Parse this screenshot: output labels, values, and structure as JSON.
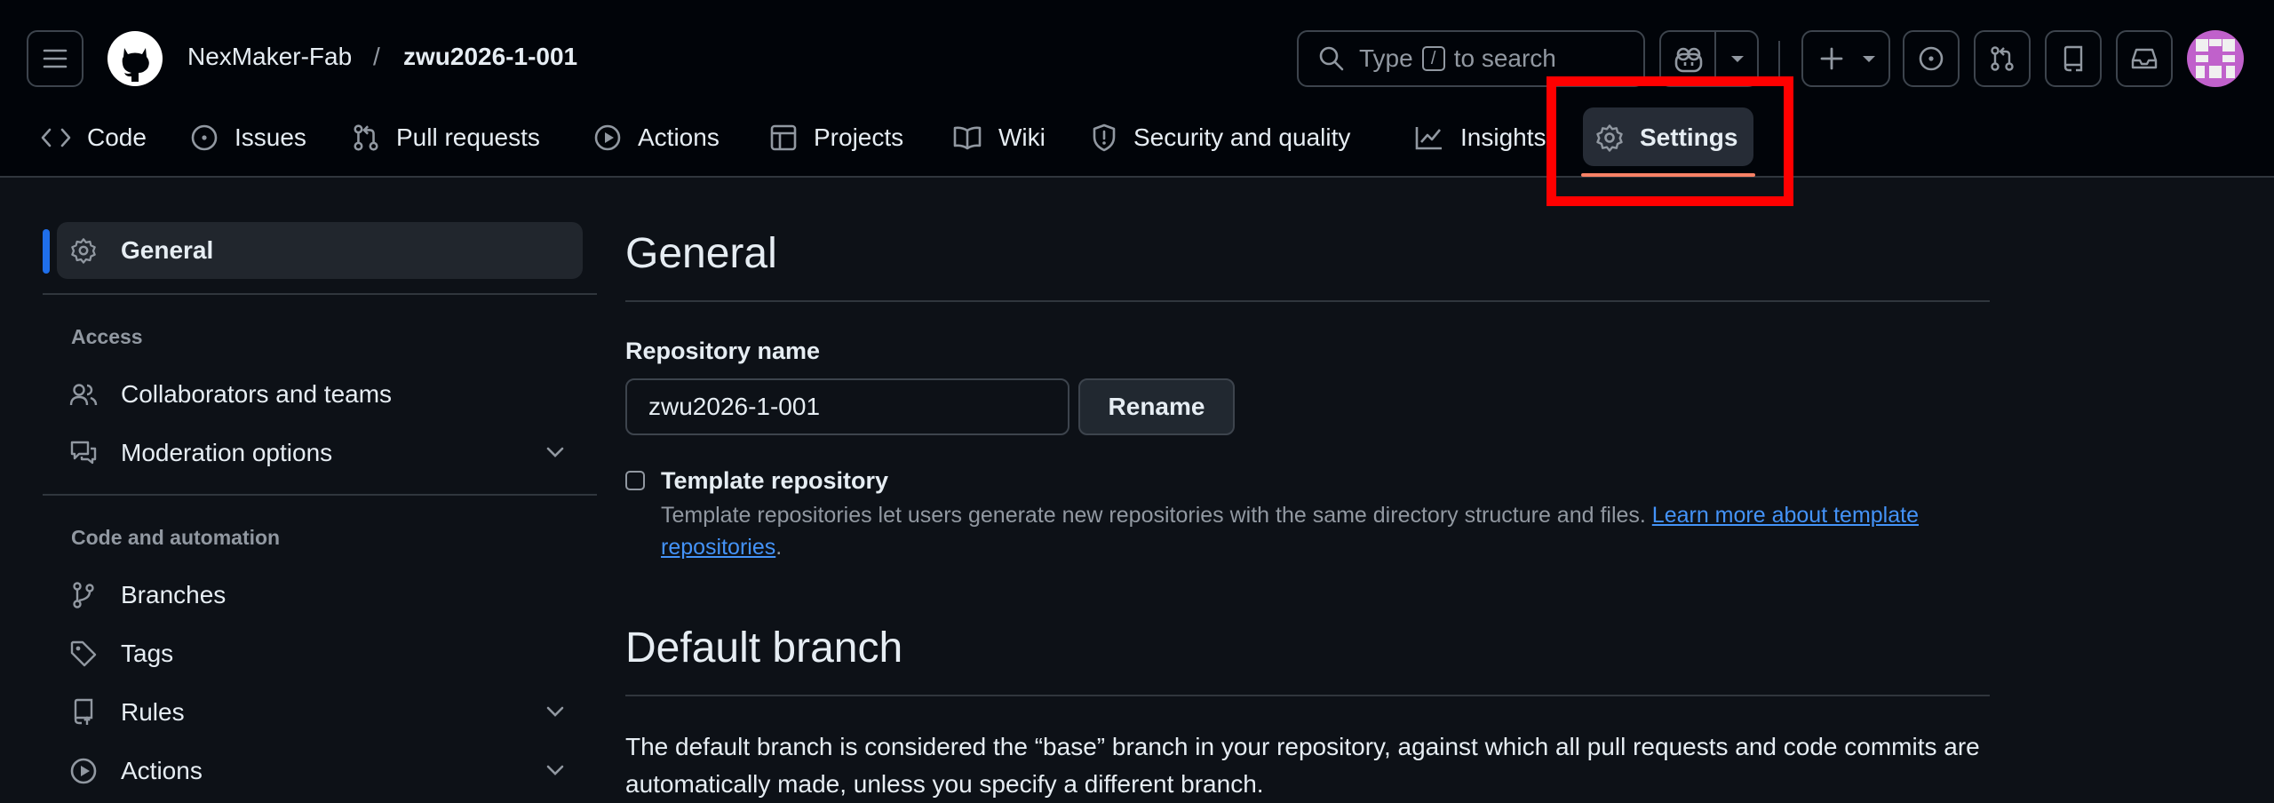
{
  "header": {
    "owner": "NexMaker-Fab",
    "separator": "/",
    "repo": "zwu2026-1-001",
    "search": {
      "prefix": "Type",
      "key": "/",
      "suffix": "to search"
    }
  },
  "tabs": [
    {
      "label": "Code"
    },
    {
      "label": "Issues"
    },
    {
      "label": "Pull requests"
    },
    {
      "label": "Actions"
    },
    {
      "label": "Projects"
    },
    {
      "label": "Wiki"
    },
    {
      "label": "Security and quality"
    },
    {
      "label": "Insights"
    },
    {
      "label": "Settings",
      "active": true
    }
  ],
  "sidebar": {
    "general": "General",
    "sections": [
      {
        "heading": "Access",
        "items": [
          "Collaborators and teams",
          "Moderation options"
        ]
      },
      {
        "heading": "Code and automation",
        "items": [
          "Branches",
          "Tags",
          "Rules",
          "Actions"
        ]
      }
    ]
  },
  "main": {
    "title": "General",
    "repo_name_label": "Repository name",
    "repo_name_value": "zwu2026-1-001",
    "rename_label": "Rename",
    "template_label": "Template repository",
    "template_desc": "Template repositories let users generate new repositories with the same directory structure and files. ",
    "template_link": "Learn more about template repositories",
    "template_end": ".",
    "default_branch_title": "Default branch",
    "default_branch_desc": "The default branch is considered the “base” branch in your repository, against which all pull requests and code commits are automatically made, unless you specify a different branch."
  },
  "colors": {
    "accent": "#f78166",
    "highlight": "#ff0000",
    "link": "#4493f8"
  }
}
